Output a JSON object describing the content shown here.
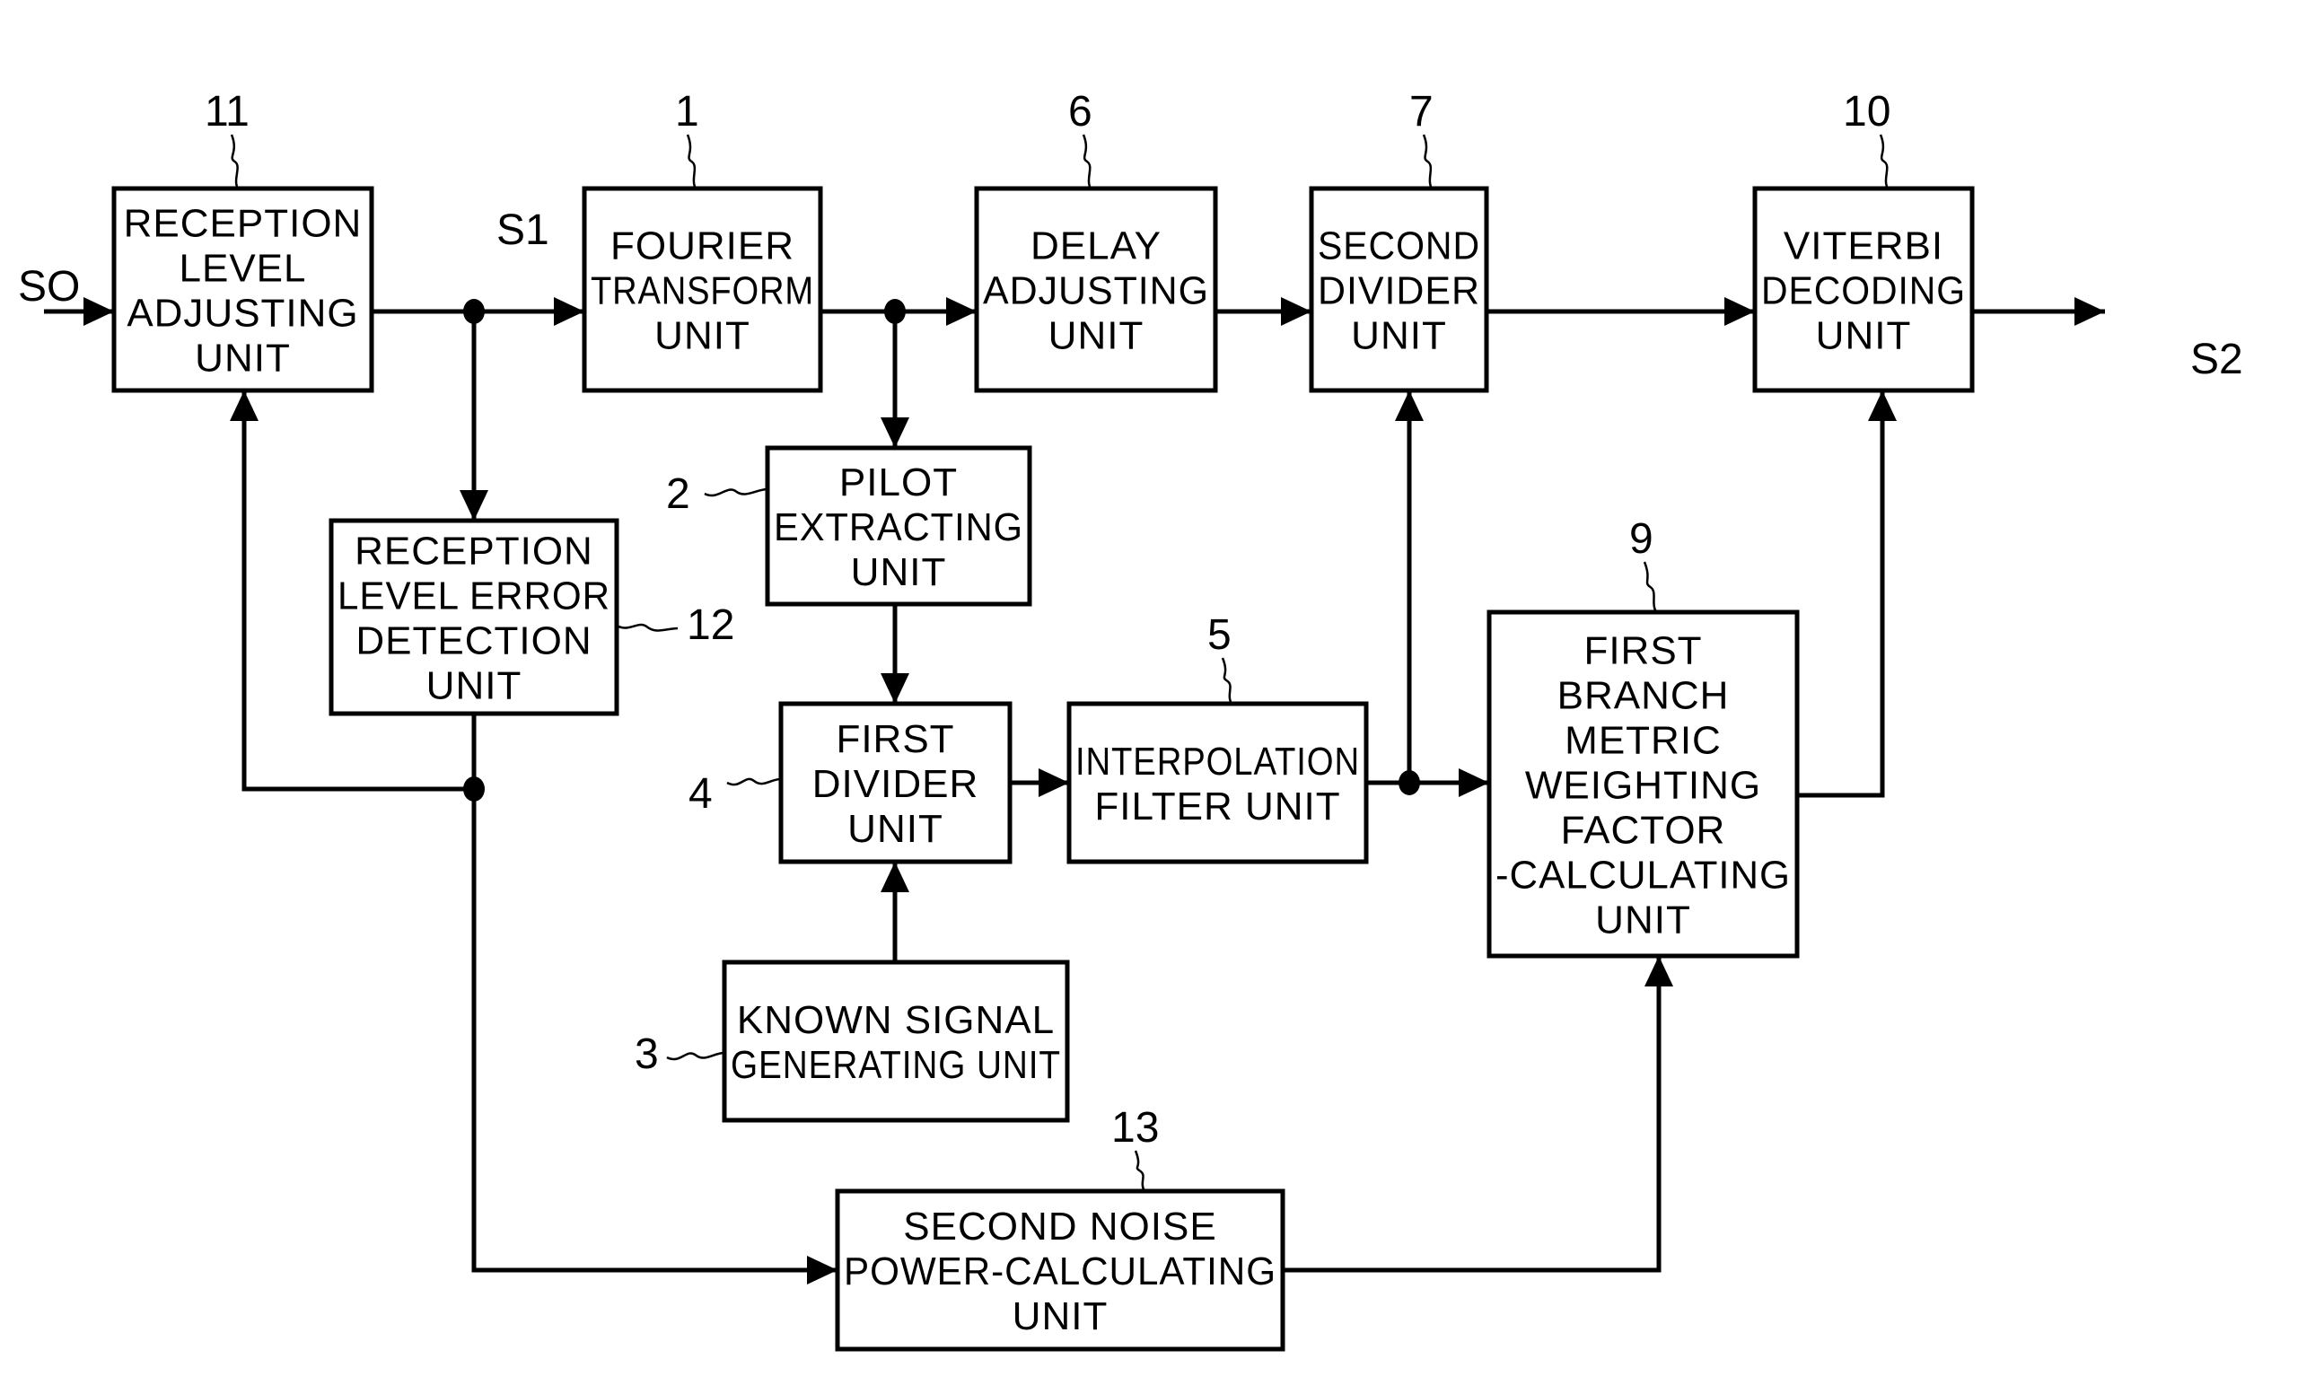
{
  "figure": {
    "blocks": {
      "b11": {
        "ref": "11",
        "lines": [
          "RECEPTION",
          "LEVEL",
          "ADJUSTING",
          "UNIT"
        ]
      },
      "b1": {
        "ref": "1",
        "lines": [
          "FOURIER",
          "TRANSFORM",
          "UNIT"
        ]
      },
      "b6": {
        "ref": "6",
        "lines": [
          "DELAY",
          "ADJUSTING",
          "UNIT"
        ]
      },
      "b7": {
        "ref": "7",
        "lines": [
          "SECOND",
          "DIVIDER",
          "UNIT"
        ]
      },
      "b10": {
        "ref": "10",
        "lines": [
          "VITERBI",
          "DECODING",
          "UNIT"
        ]
      },
      "b2": {
        "ref": "2",
        "lines": [
          "PILOT",
          "EXTRACTING",
          "UNIT"
        ]
      },
      "b12": {
        "ref": "12",
        "lines": [
          "RECEPTION",
          "LEVEL ERROR",
          "DETECTION",
          "UNIT"
        ]
      },
      "b4": {
        "ref": "4",
        "lines": [
          "FIRST",
          "DIVIDER",
          "UNIT"
        ]
      },
      "b5": {
        "ref": "5",
        "lines": [
          "INTERPOLATION",
          "FILTER UNIT"
        ]
      },
      "b9": {
        "ref": "9",
        "lines": [
          "FIRST",
          "BRANCH",
          "METRIC",
          "WEIGHTING",
          "FACTOR",
          "-CALCULATING",
          "UNIT"
        ]
      },
      "b3": {
        "ref": "3",
        "lines": [
          "KNOWN SIGNAL",
          "GENERATING UNIT"
        ]
      },
      "b13": {
        "ref": "13",
        "lines": [
          "SECOND NOISE",
          "POWER-CALCULATING",
          "UNIT"
        ]
      }
    },
    "signals": {
      "s0": "SO",
      "s1": "S1",
      "s2": "S2"
    }
  }
}
